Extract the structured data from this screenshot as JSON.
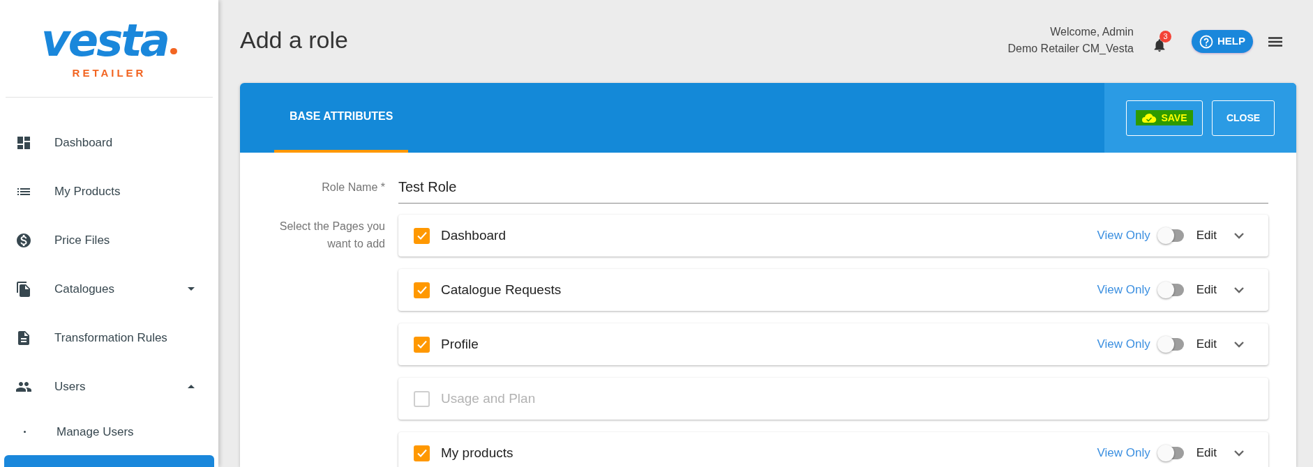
{
  "sidebar": {
    "logo": {
      "word": "vesta",
      "subtitle": "RETAILER"
    },
    "items": [
      {
        "label": "Dashboard",
        "selected": false
      },
      {
        "label": "My Products",
        "selected": false
      },
      {
        "label": "Price Files",
        "selected": false
      },
      {
        "label": "Catalogues",
        "selected": false,
        "expanded": false
      },
      {
        "label": "Transformation Rules",
        "selected": false
      },
      {
        "label": "Users",
        "selected": false,
        "expanded": true,
        "children": [
          {
            "label": "Manage Users",
            "selected": false
          },
          {
            "selected": true
          }
        ]
      }
    ]
  },
  "header": {
    "title": "Add a role",
    "welcome": "Welcome, Admin",
    "account": "Demo Retailer CM_Vesta",
    "notifications": "3",
    "help": "HELP"
  },
  "card": {
    "tabs": [
      {
        "label": "BASE ATTRIBUTES",
        "selected": true
      }
    ],
    "save": "SAVE",
    "close": "CLOSE",
    "role_name": {
      "label": "Role Name *",
      "value": "Test Role"
    },
    "pages_label": "Select the Pages you want to add",
    "pages": [
      {
        "label": "Dashboard",
        "checked": true,
        "view_label": "View Only",
        "edit_label": "Edit",
        "edit_on": false
      },
      {
        "label": "Catalogue Requests",
        "checked": true,
        "view_label": "View Only",
        "edit_label": "Edit",
        "edit_on": false
      },
      {
        "label": "Profile",
        "checked": true,
        "view_label": "View Only",
        "edit_label": "Edit",
        "edit_on": false
      },
      {
        "label": "Usage and Plan",
        "checked": false
      },
      {
        "label": "My products",
        "checked": true,
        "view_label": "View Only",
        "edit_label": "Edit",
        "edit_on": false
      }
    ]
  }
}
